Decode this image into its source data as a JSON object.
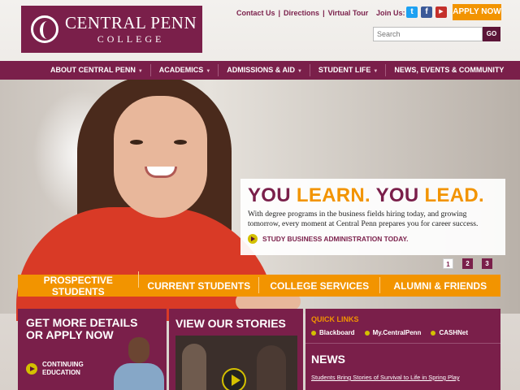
{
  "brand": {
    "name_line1": "CENTRAL PENN",
    "name_line2": "COLLEGE",
    "color_primary": "#7a1f4a",
    "color_accent": "#f29400",
    "color_play": "#d3c000"
  },
  "utility_links": [
    "Contact Us",
    "Directions",
    "Virtual Tour"
  ],
  "social": {
    "label": "Join Us:",
    "icons": [
      "twitter-icon",
      "facebook-icon",
      "youtube-icon"
    ]
  },
  "apply_button": "APPLY NOW",
  "search": {
    "placeholder": "Search",
    "button": "GO"
  },
  "main_nav": [
    {
      "label": "ABOUT CENTRAL PENN",
      "has_dropdown": true
    },
    {
      "label": "ACADEMICS",
      "has_dropdown": true
    },
    {
      "label": "ADMISSIONS & AID",
      "has_dropdown": true
    },
    {
      "label": "STUDENT LIFE",
      "has_dropdown": true
    },
    {
      "label": "NEWS, EVENTS & COMMUNITY",
      "has_dropdown": false
    }
  ],
  "hero": {
    "headline_part1": "YOU ",
    "headline_part2": "LEARN.",
    "headline_part3": " YOU ",
    "headline_part4": "LEAD.",
    "body": "With degree programs in the business fields hiring today, and growing tomorrow, every moment at Central Penn prepares you for career success.",
    "cta": "STUDY BUSINESS ADMINISTRATION TODAY.",
    "pager": [
      "1",
      "2",
      "3"
    ],
    "pager_active": "1"
  },
  "audience_nav": [
    "PROSPECTIVE STUDENTS",
    "CURRENT STUDENTS",
    "COLLEGE SERVICES",
    "ALUMNI & FRIENDS"
  ],
  "details": {
    "title_line1": "GET MORE DETAILS",
    "title_line2": "OR APPLY NOW",
    "link_line1": "CONTINUING",
    "link_line2": "EDUCATION"
  },
  "stories": {
    "title": "VIEW OUR STORIES"
  },
  "quick_links": {
    "title": "QUICK LINKS",
    "items": [
      "Blackboard",
      "My.CentralPenn",
      "CASHNet"
    ]
  },
  "news": {
    "title": "NEWS",
    "items": [
      "Students Bring Stories of Survival to Life in Spring Play"
    ]
  }
}
